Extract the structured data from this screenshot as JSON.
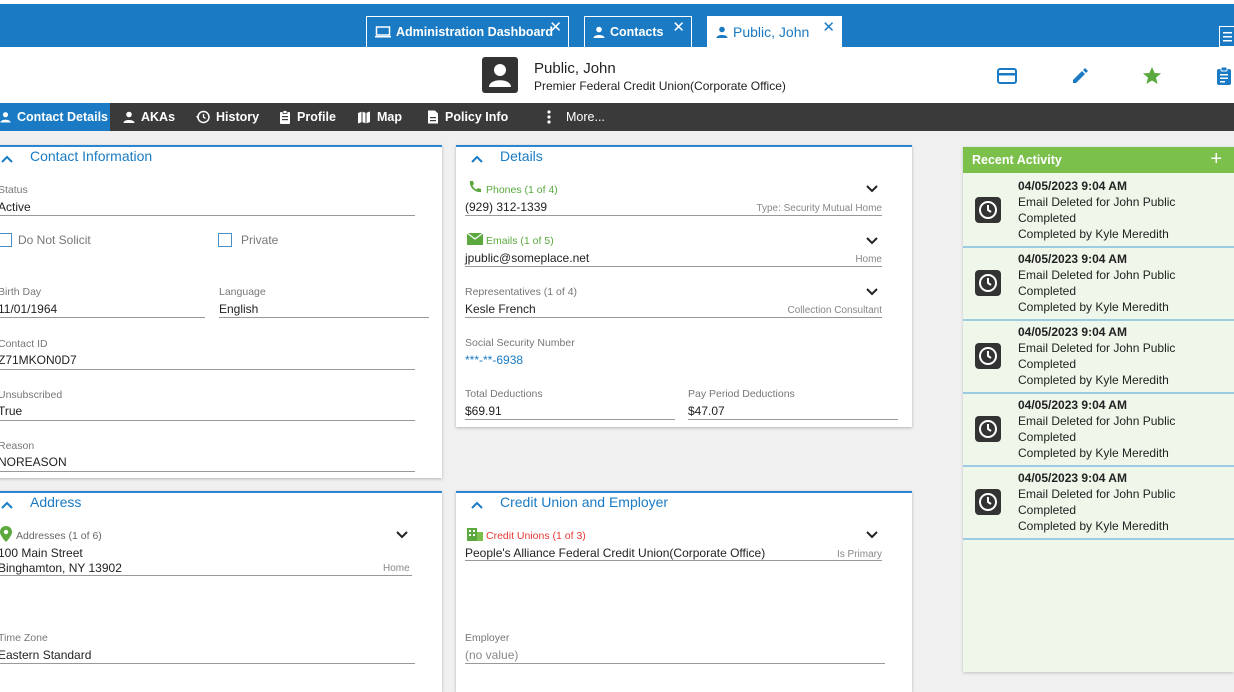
{
  "tabs": [
    {
      "label": "Administration Dashboard",
      "icon": "monitor-icon"
    },
    {
      "label": "Contacts",
      "icon": "person-icon"
    },
    {
      "label": "Public, John",
      "icon": "person-icon",
      "active": true
    }
  ],
  "header": {
    "name": "Public, John",
    "organization": "Premier Federal Credit Union(Corporate Office)",
    "actions": [
      "card-icon",
      "pencil-icon",
      "star-icon",
      "clipboard-icon"
    ]
  },
  "nav": [
    {
      "label": "Contact Details",
      "icon": "person-icon",
      "active": true
    },
    {
      "label": "AKAs",
      "icon": "person-icon"
    },
    {
      "label": "History",
      "icon": "history-icon"
    },
    {
      "label": "Profile",
      "icon": "clipboard-icon"
    },
    {
      "label": "Map",
      "icon": "map-icon"
    },
    {
      "label": "Policy Info",
      "icon": "document-icon"
    },
    {
      "label": "More...",
      "icon": "kebab-icon"
    }
  ],
  "contact_info": {
    "title": "Contact Information",
    "status_label": "Status",
    "status_value": "Active",
    "do_not_solicit": "Do Not Solicit",
    "private": "Private",
    "birthday_label": "Birth Day",
    "birthday_value": "11/01/1964",
    "language_label": "Language",
    "language_value": "English",
    "contact_id_label": "Contact ID",
    "contact_id_value": "Z71MKON0D7",
    "unsubscribed_label": "Unsubscribed",
    "unsubscribed_value": "True",
    "reason_label": "Reason",
    "reason_value": "NOREASON"
  },
  "details": {
    "title": "Details",
    "phones_label": "Phones (1 of 4)",
    "phone_value": "(929) 312-1339",
    "phone_type": "Type: Security Mutual Home",
    "emails_label": "Emails (1 of 5)",
    "email_value": "jpublic@someplace.net",
    "email_type": "Home",
    "reps_label": "Representatives (1 of 4)",
    "rep_value": "Kesle French",
    "rep_type": "Collection Consultant",
    "ssn_label": "Social Security Number",
    "ssn_value": "***-**-6938",
    "total_deductions_label": "Total Deductions",
    "total_deductions_value": "$69.91",
    "pay_period_label": "Pay Period Deductions",
    "pay_period_value": "$47.07"
  },
  "address": {
    "title": "Address",
    "addresses_label": "Addresses (1 of 6)",
    "line1": "100 Main Street",
    "line2": "Binghamton, NY  13902",
    "type": "Home",
    "timezone_label": "Time Zone",
    "timezone_value": "Eastern Standard"
  },
  "credit_union": {
    "title": "Credit Union and Employer",
    "cu_label": "Credit Unions (1 of 3)",
    "cu_value": "People's Alliance Federal Credit Union(Corporate Office)",
    "cu_type": "Is Primary",
    "employer_label": "Employer",
    "employer_value": "(no value)"
  },
  "activity": {
    "title": "Recent Activity",
    "add": "+",
    "items": [
      {
        "date": "04/05/2023 9:04 AM",
        "desc": "Email Deleted for John Public",
        "status": "Completed",
        "by": "Completed by Kyle Meredith"
      },
      {
        "date": "04/05/2023 9:04 AM",
        "desc": "Email Deleted for John Public",
        "status": "Completed",
        "by": "Completed by Kyle Meredith"
      },
      {
        "date": "04/05/2023 9:04 AM",
        "desc": "Email Deleted for John Public",
        "status": "Completed",
        "by": "Completed by Kyle Meredith"
      },
      {
        "date": "04/05/2023 9:04 AM",
        "desc": "Email Deleted for John Public",
        "status": "Completed",
        "by": "Completed by Kyle Meredith"
      },
      {
        "date": "04/05/2023 9:04 AM",
        "desc": "Email Deleted for John Public",
        "status": "Completed",
        "by": "Completed by Kyle Meredith"
      }
    ]
  },
  "colors": {
    "primary": "#1a7bc4",
    "nav_bg": "#3a3a3a",
    "activity_header": "#7cc04c",
    "green": "#5aa83e",
    "red": "#e53935"
  }
}
